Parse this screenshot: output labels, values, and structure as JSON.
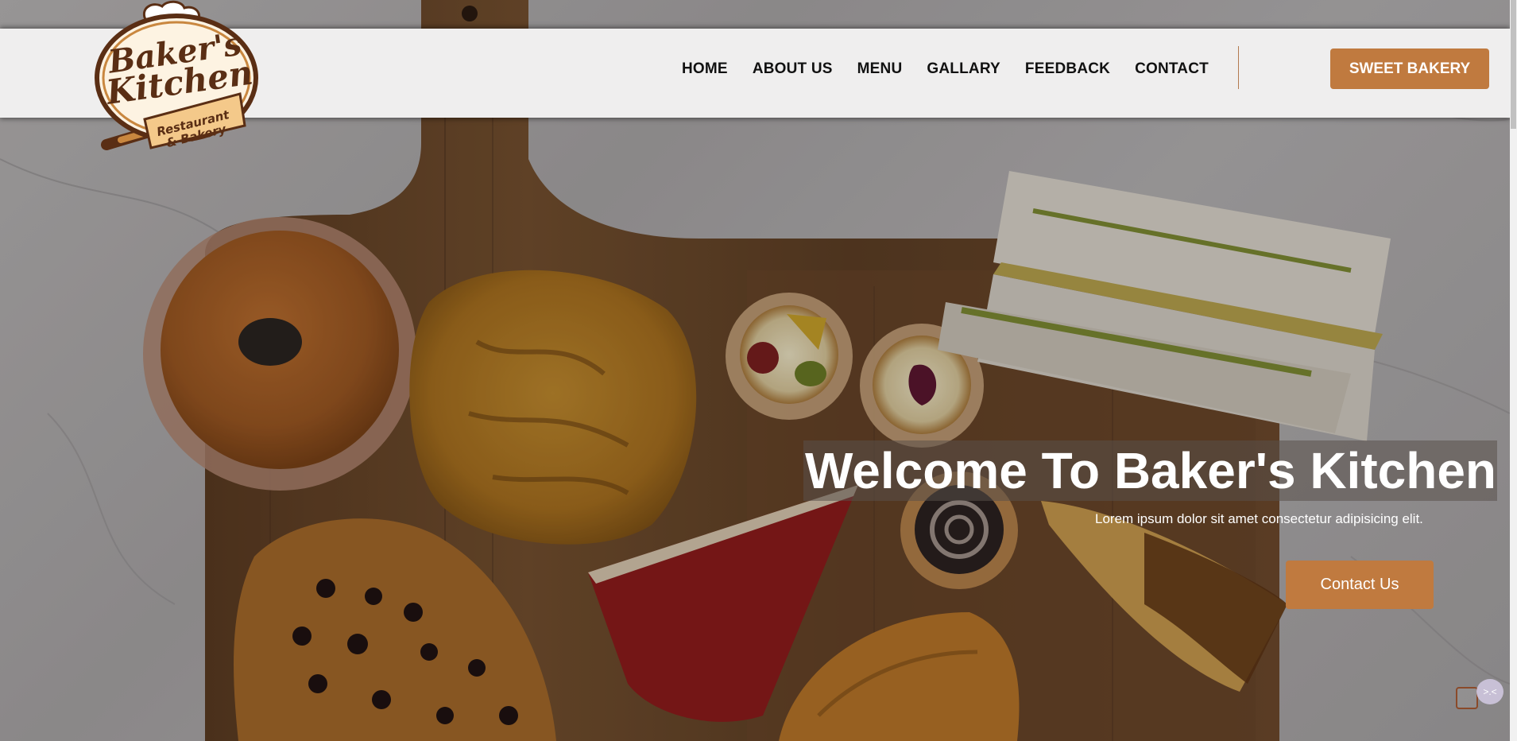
{
  "brand": {
    "logo_line1": "Baker's",
    "logo_line2": "Kitchen",
    "logo_line3": "Restaurant",
    "logo_line4": "& Bakery"
  },
  "nav": {
    "items": [
      "HOME",
      "ABOUT US",
      "MENU",
      "GALLARY",
      "FEEDBACK",
      "CONTACT"
    ]
  },
  "header_cta": "SWEET BAKERY",
  "hero": {
    "title": "Welcome To Baker's Kitchen",
    "subtitle": "Lorem ipsum dolor sit amet consectetur adipisicing elit.",
    "cta": "Contact Us"
  },
  "widget": {
    "bubble_glyph": ">.<"
  },
  "colors": {
    "accent": "#c07a3f",
    "header_bg": "#efeeee",
    "board": "#6e4a2c"
  }
}
